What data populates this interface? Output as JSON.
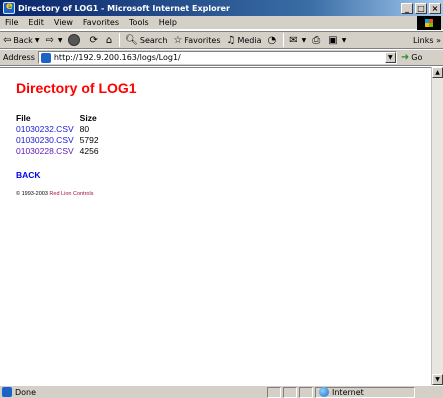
{
  "window": {
    "title": "Directory of LOG1 - Microsoft Internet Explorer",
    "controls": [
      "_",
      "□",
      "×"
    ]
  },
  "menu": [
    "File",
    "Edit",
    "View",
    "Favorites",
    "Tools",
    "Help"
  ],
  "toolbar": {
    "back": "Back",
    "search": "Search",
    "favorites": "Favorites",
    "media": "Media",
    "links": "Links »"
  },
  "address": {
    "label": "Address",
    "url": "http://192.9.200.163/logs/Log1/",
    "go": "Go"
  },
  "page": {
    "title": "Directory of LOG1",
    "headers": {
      "file": "File",
      "size": "Size"
    },
    "files": [
      {
        "name": "01030232.CSV",
        "size": "80"
      },
      {
        "name": "01030230.CSV",
        "size": "5792"
      },
      {
        "name": "01030228.CSV",
        "size": "4256"
      }
    ],
    "back": "BACK",
    "copyright_prefix": "© 1993-2003",
    "copyright_company": "Red Lion Controls"
  },
  "status": {
    "text": "Done",
    "zone": "Internet"
  }
}
